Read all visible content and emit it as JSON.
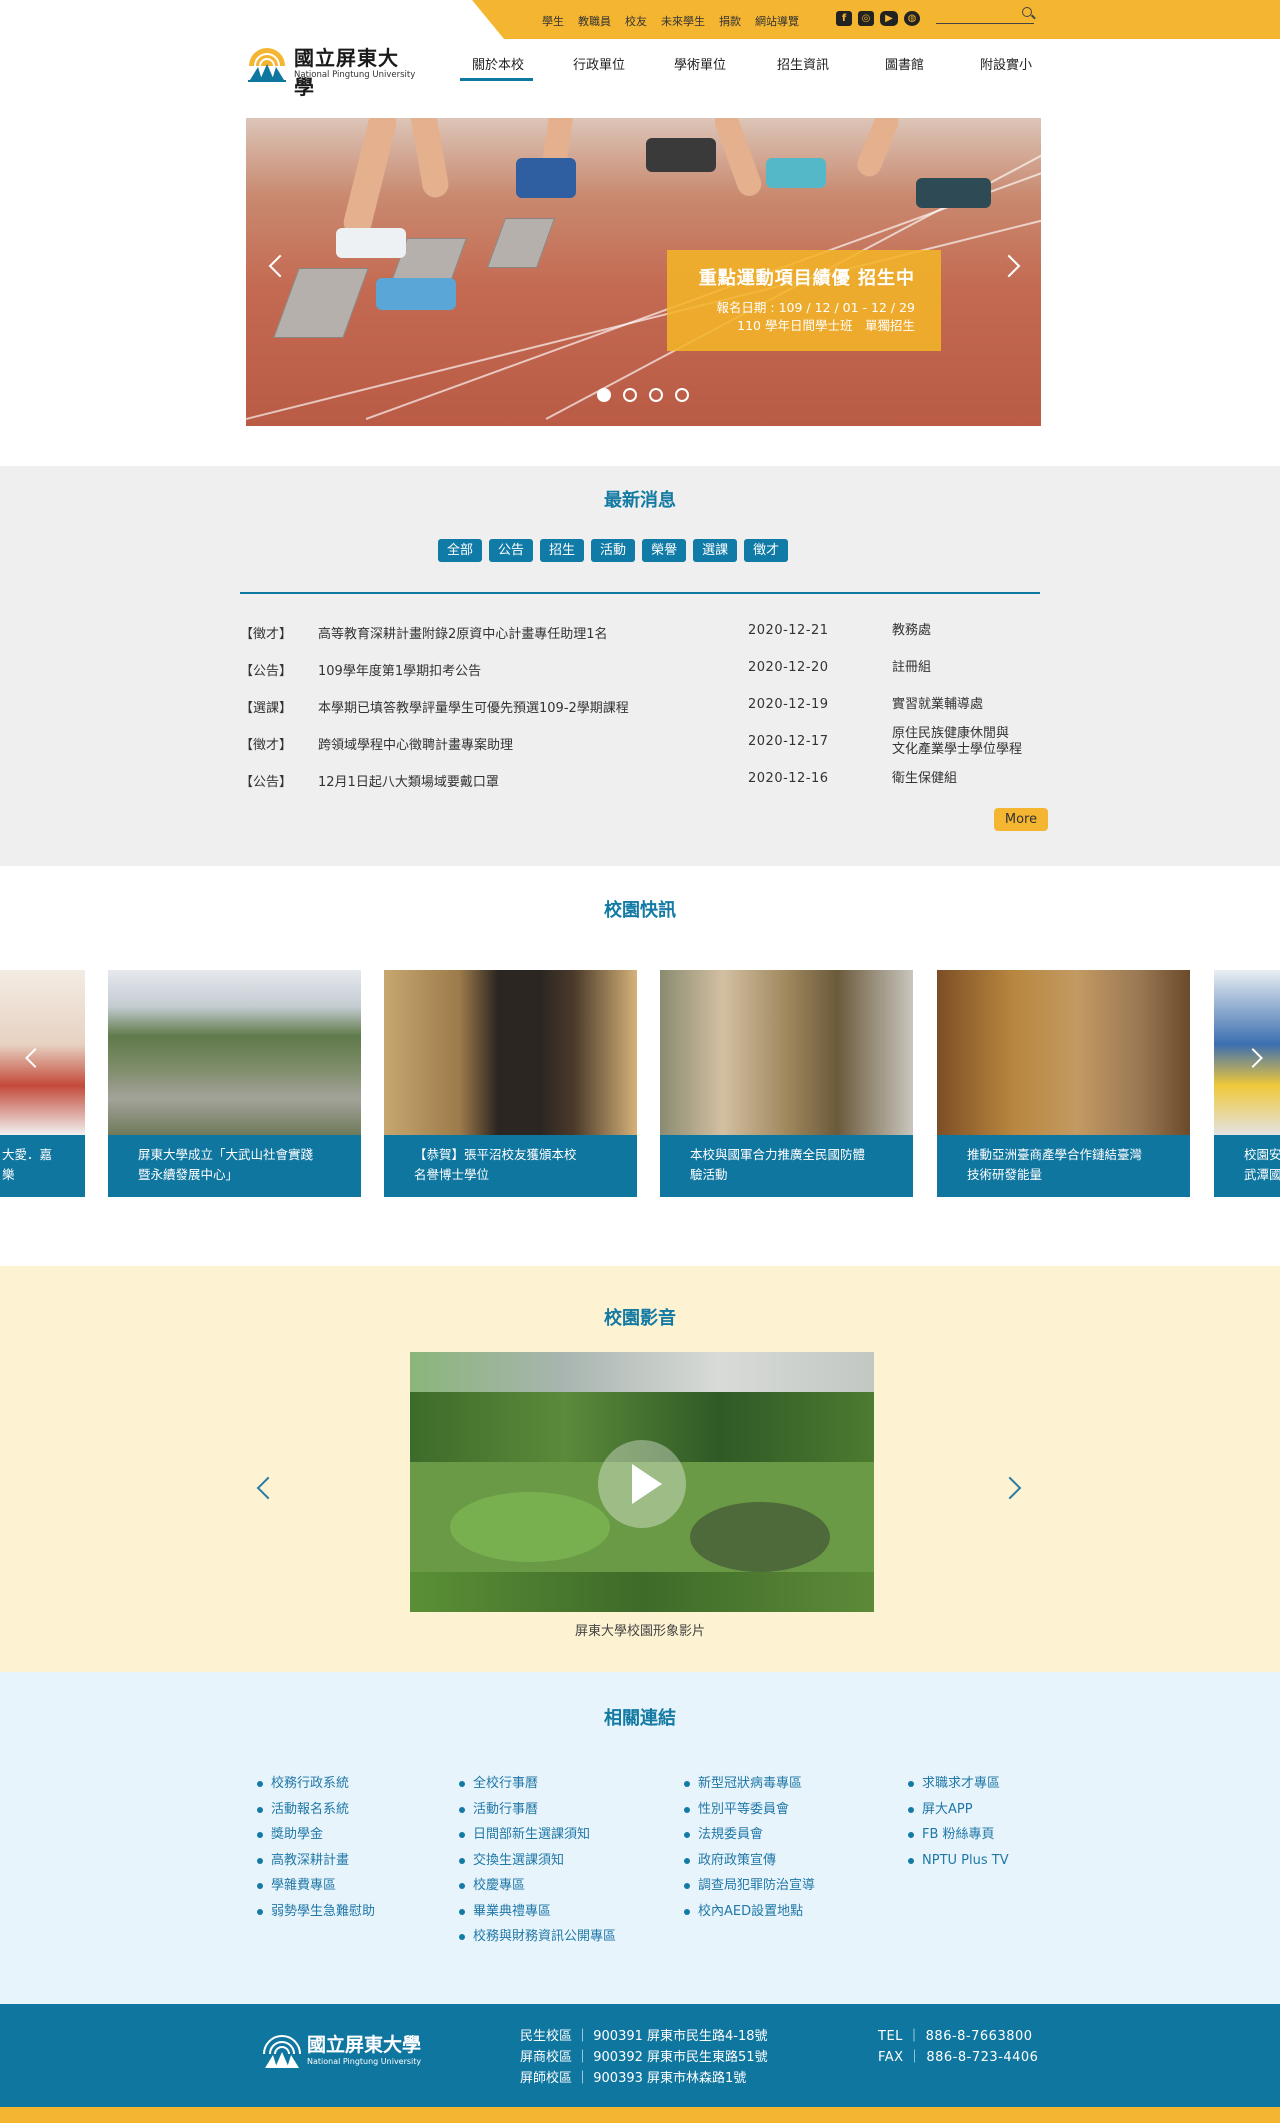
{
  "topbar": {
    "links": [
      "學生",
      "教職員",
      "校友",
      "未來學生",
      "捐款",
      "網站導覽"
    ],
    "social": [
      "facebook-icon",
      "instagram-icon",
      "youtube-icon",
      "globe-icon"
    ],
    "search_placeholder": ""
  },
  "logo": {
    "zh": "國立屏東大學",
    "en": "National Pingtung University"
  },
  "nav": {
    "items": [
      "關於本校",
      "行政單位",
      "學術單位",
      "招生資訊",
      "圖書館",
      "附設實小"
    ],
    "active": "關於本校"
  },
  "hero": {
    "title": "重點運動項目績優 招生中",
    "line1": "報名日期 : 109 / 12 / 01  -  12 / 29",
    "line2": "110 學年日間學士班　單獨招生",
    "slide_count": 4,
    "active_slide": 1
  },
  "news": {
    "title": "最新消息",
    "tags": [
      "全部",
      "公告",
      "招生",
      "活動",
      "榮譽",
      "選課",
      "徵才"
    ],
    "rows": [
      {
        "cat": "【徵才】",
        "title": "高等教育深耕計畫附錄2原資中心計畫專任助理1名",
        "date": "2020-12-21",
        "unit": "教務處"
      },
      {
        "cat": "【公告】",
        "title": "109學年度第1學期扣考公告",
        "date": "2020-12-20",
        "unit": "註冊組"
      },
      {
        "cat": "【選課】",
        "title": "本學期已填答教學評量學生可優先預選109-2學期課程",
        "date": "2020-12-19",
        "unit": "實習就業輔導處"
      },
      {
        "cat": "【徵才】",
        "title": "跨領域學程中心徵聘計畫專案助理",
        "date": "2020-12-17",
        "unit": "原住民族健康休閒與",
        "unit2": "文化產業學士學位學程"
      },
      {
        "cat": "【公告】",
        "title": "12月1日起八大類場域要戴口罩",
        "date": "2020-12-16",
        "unit": "衛生保健組"
      }
    ],
    "more": "More"
  },
  "campus": {
    "title": "校園快訊",
    "cards": [
      {
        "l1": "大愛．嘉樂",
        "l2": ""
      },
      {
        "l1": "屏東大學成立「大武山社會實踐",
        "l2": "暨永續發展中心」"
      },
      {
        "l1": "【恭賀】張平沼校友獲頒本校",
        "l2": "名譽博士學位"
      },
      {
        "l1": "本校與國軍合力推廣全民國防體",
        "l2": "驗活動"
      },
      {
        "l1": "推動亞洲臺商產學合作鏈結臺灣",
        "l2": "技術研發能量"
      },
      {
        "l1": "校園安",
        "l2": "武潭國"
      }
    ]
  },
  "video": {
    "title": "校園影音",
    "caption": "屏東大學校園形象影片"
  },
  "links": {
    "title": "相關連結",
    "col1": [
      "校務行政系統",
      "活動報名系統",
      "獎助學金",
      "高教深耕計畫",
      "學雜費專區",
      "弱勢學生急難慰助"
    ],
    "col2": [
      "全校行事曆",
      "活動行事曆",
      "日間部新生選課須知",
      "交換生選課須知",
      "校慶專區",
      "畢業典禮專區",
      "校務與財務資訊公開專區"
    ],
    "col3": [
      "新型冠狀病毒專區",
      "性別平等委員會",
      "法規委員會",
      "政府政策宣傳",
      "調查局犯罪防治宣導",
      "校內AED設置地點"
    ],
    "col4": [
      "求職求才專區",
      "屏大APP",
      "FB 粉絲專頁",
      "NPTU Plus TV"
    ]
  },
  "footer": {
    "logo_zh": "國立屏東大學",
    "logo_en": "National Pingtung University",
    "addr": [
      "民生校區 ｜ 900391 屏東市民生路4-18號",
      "屏商校區 ｜ 900392 屏東市民生東路51號",
      "屏師校區 ｜ 900393 屏東市林森路1號"
    ],
    "tel": "TEL ｜ 886-8-7663800",
    "fax": "FAX ｜ 886-8-723-4406"
  },
  "colors": {
    "accent_yellow": "#f4b531",
    "brand_blue": "#0f76a0"
  }
}
